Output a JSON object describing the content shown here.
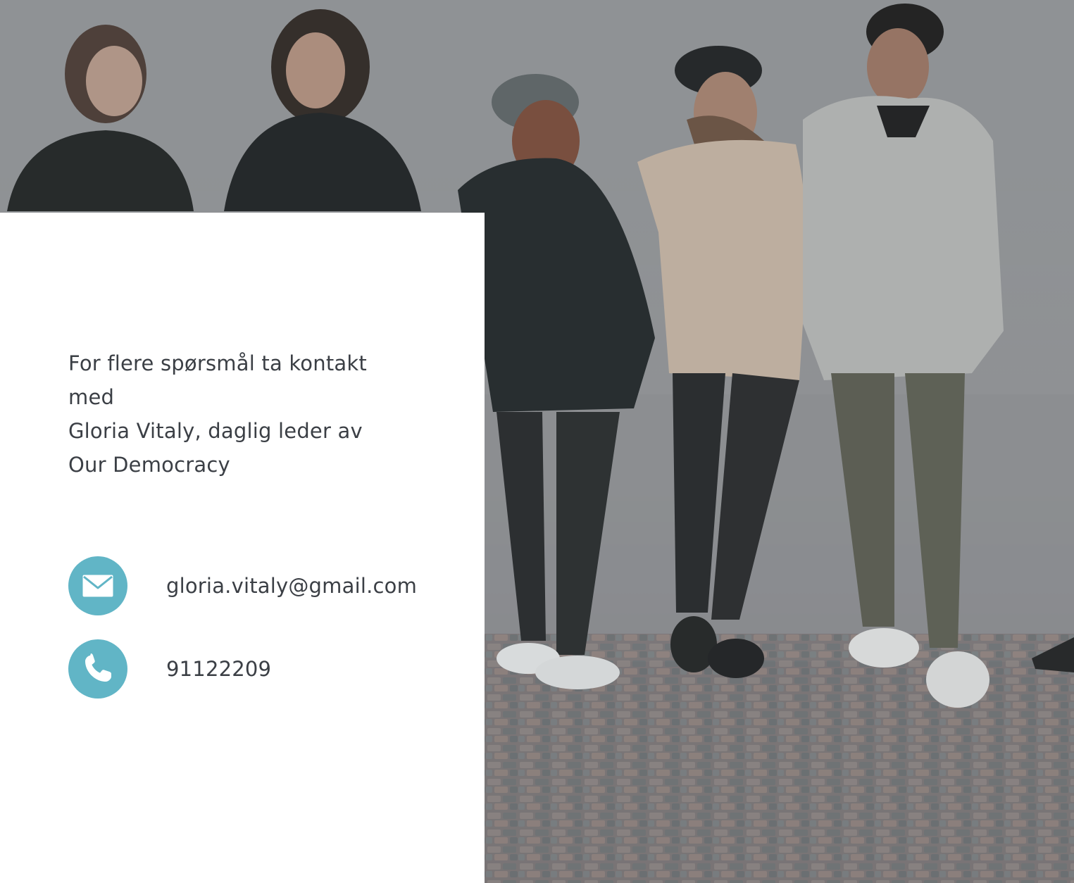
{
  "intro": {
    "line1": "For flere spørsmål ta kontakt",
    "line2": "med",
    "line3": "Gloria Vitaly, daglig leder av",
    "line4": "Our Democracy"
  },
  "contacts": {
    "email": {
      "icon": "envelope-icon",
      "text": "gloria.vitaly@gmail.com"
    },
    "phone": {
      "icon": "phone-icon",
      "text": "91122209"
    }
  },
  "colors": {
    "accent": "#61b5c6",
    "text": "#3b3f45",
    "card": "#ffffff"
  },
  "image": {
    "subject": "group of young people standing against a grey wall on cobblestones"
  }
}
